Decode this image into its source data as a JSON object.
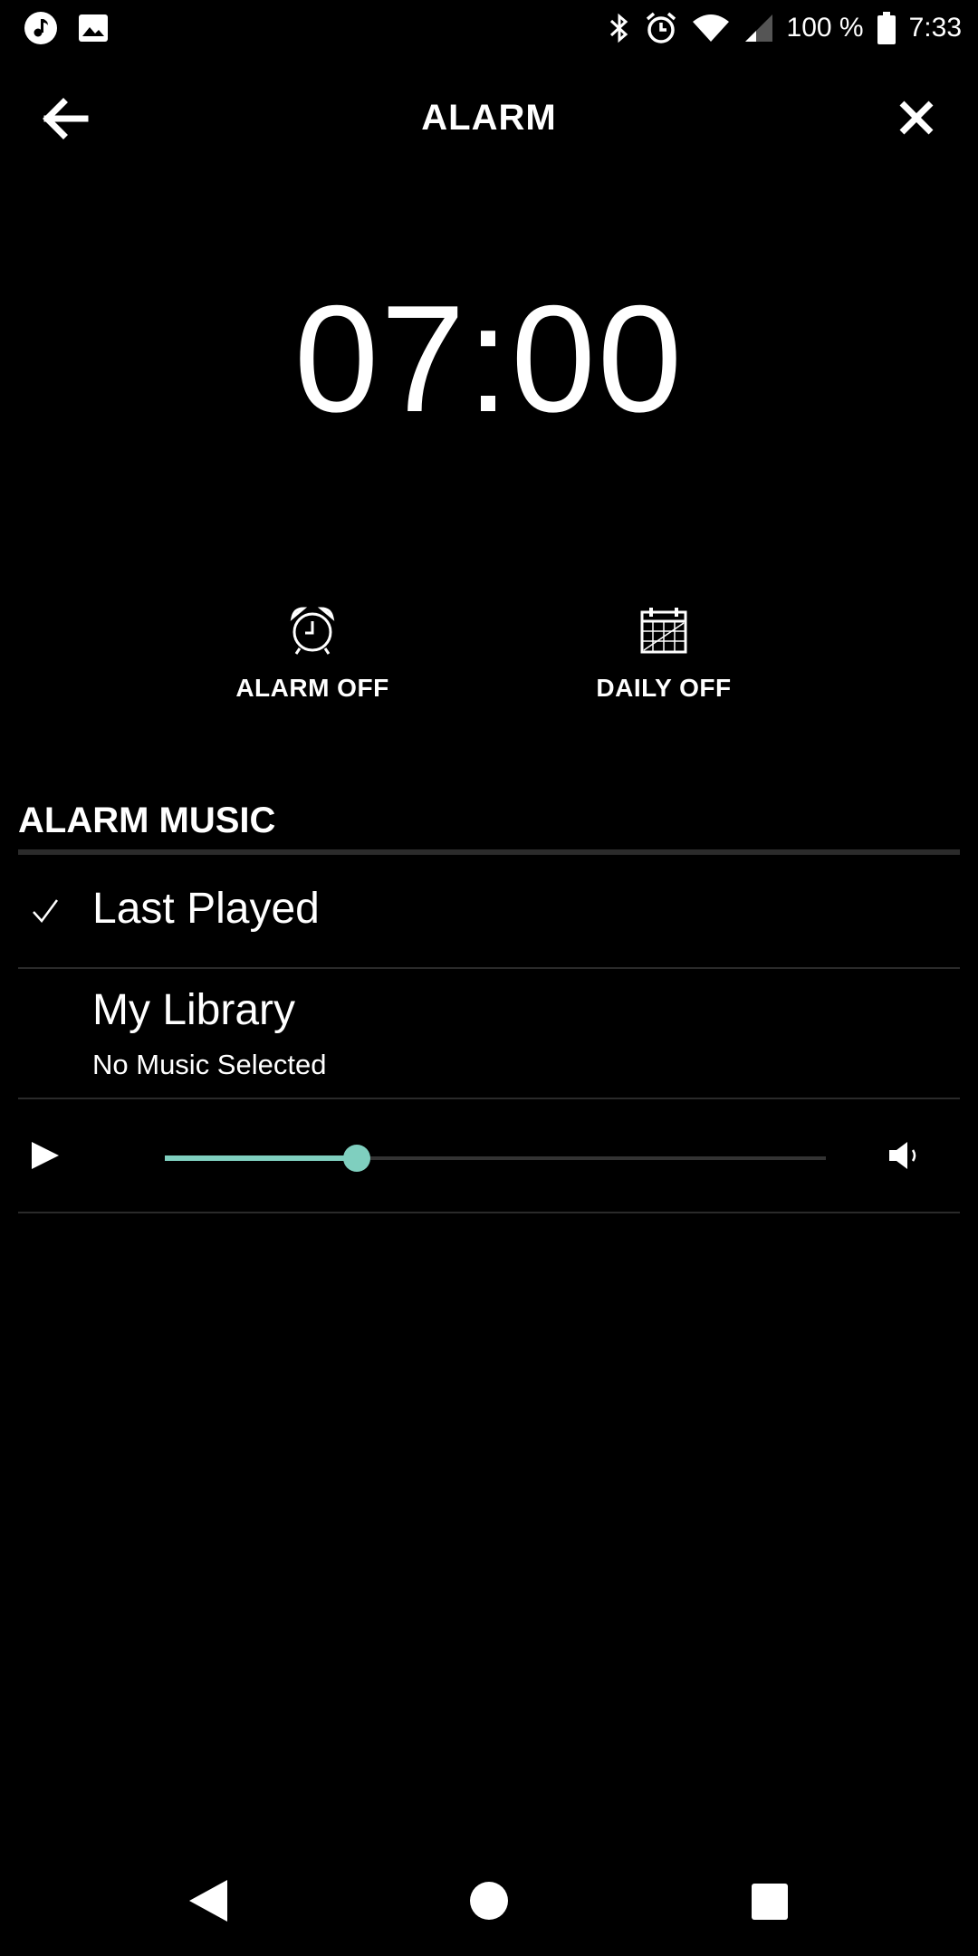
{
  "status_bar": {
    "battery_percent": "100 %",
    "time": "7:33",
    "icons": [
      "music-note-icon",
      "image-icon",
      "bluetooth-icon",
      "alarm-clock-icon",
      "wifi-icon",
      "cell-signal-icon",
      "battery-icon"
    ]
  },
  "header": {
    "title": "ALARM",
    "back_icon": "arrow-left-icon",
    "close_icon": "close-icon"
  },
  "alarm_time": "07:00",
  "toggles": {
    "alarm": {
      "label": "ALARM OFF",
      "icon": "alarm-clock-icon"
    },
    "daily": {
      "label": "DAILY OFF",
      "icon": "calendar-icon"
    }
  },
  "alarm_music": {
    "section_title": "ALARM MUSIC",
    "options": [
      {
        "label": "Last Played",
        "selected": true
      },
      {
        "label": "My Library",
        "subtitle": "No Music Selected",
        "selected": false
      }
    ]
  },
  "player": {
    "play_icon": "play-icon",
    "volume_icon": "volume-icon",
    "volume_level": 0.29,
    "accent_color": "#7fcfbf"
  },
  "nav_bar": {
    "icons": [
      "nav-back-icon",
      "nav-home-icon",
      "nav-recents-icon"
    ]
  }
}
